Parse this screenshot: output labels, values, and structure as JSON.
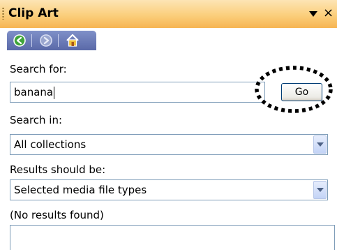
{
  "panel": {
    "title": "Clip Art",
    "dropdown_icon": "dropdown-triangle-icon",
    "close_label": "×"
  },
  "toolbar": {
    "buttons": [
      {
        "icon": "back-icon",
        "label": "Back"
      },
      {
        "icon": "forward-icon",
        "label": "Forward"
      },
      {
        "icon": "home-icon",
        "label": "Home"
      }
    ]
  },
  "search": {
    "label": "Search for:",
    "value": "banana",
    "go_label": "Go"
  },
  "search_in": {
    "label": "Search in:",
    "selected": "All collections"
  },
  "results_type": {
    "label": "Results should be:",
    "selected": "Selected media file types"
  },
  "results": {
    "status": "(No results found)"
  },
  "colors": {
    "title_gradient_top": "#fde5b4",
    "title_gradient_bottom": "#f6b451",
    "toolbar": "#6b7bb8",
    "input_border": "#7f9db9",
    "go_border": "#003c74"
  }
}
